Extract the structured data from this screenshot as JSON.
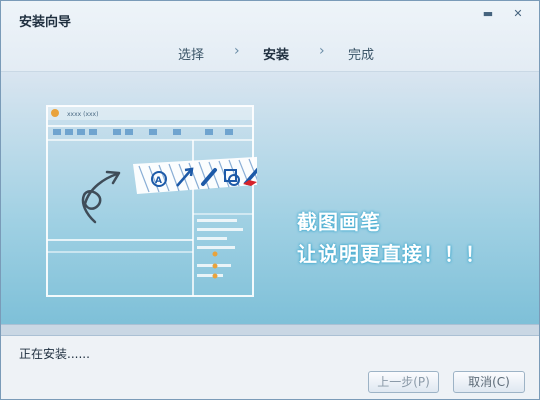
{
  "window": {
    "title": "安装向导",
    "controls": {
      "minimize": "▬",
      "close": "✕"
    }
  },
  "steps": {
    "items": [
      "选择",
      "安装",
      "完成"
    ],
    "active_index": 1,
    "separator": "›"
  },
  "banner": {
    "line1": "截图画笔",
    "line2": "让说明更直接！！！",
    "mock_window_title": "xxxx (xxx)"
  },
  "progress": {
    "value_percent": 0
  },
  "status": {
    "text": "正在安装......"
  },
  "buttons": {
    "prev_label": "上一步(P)",
    "cancel_label": "取消(C)"
  },
  "colors": {
    "accent": "#3ea9cf",
    "title_text": "#1f2f3f"
  }
}
